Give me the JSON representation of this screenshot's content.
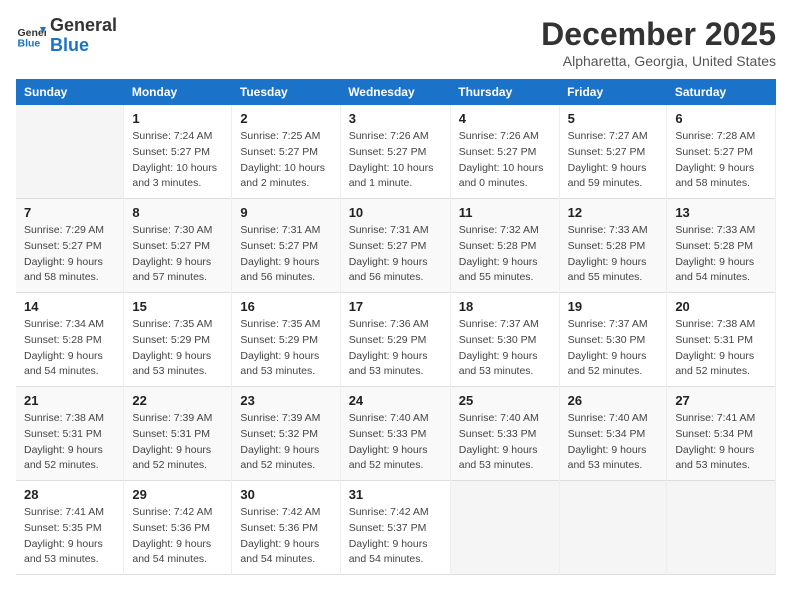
{
  "logo": {
    "line1": "General",
    "line2": "Blue"
  },
  "title": "December 2025",
  "location": "Alpharetta, Georgia, United States",
  "weekdays": [
    "Sunday",
    "Monday",
    "Tuesday",
    "Wednesday",
    "Thursday",
    "Friday",
    "Saturday"
  ],
  "weeks": [
    [
      {
        "day": "",
        "sunrise": "",
        "sunset": "",
        "daylight": ""
      },
      {
        "day": "1",
        "sunrise": "Sunrise: 7:24 AM",
        "sunset": "Sunset: 5:27 PM",
        "daylight": "Daylight: 10 hours and 3 minutes."
      },
      {
        "day": "2",
        "sunrise": "Sunrise: 7:25 AM",
        "sunset": "Sunset: 5:27 PM",
        "daylight": "Daylight: 10 hours and 2 minutes."
      },
      {
        "day": "3",
        "sunrise": "Sunrise: 7:26 AM",
        "sunset": "Sunset: 5:27 PM",
        "daylight": "Daylight: 10 hours and 1 minute."
      },
      {
        "day": "4",
        "sunrise": "Sunrise: 7:26 AM",
        "sunset": "Sunset: 5:27 PM",
        "daylight": "Daylight: 10 hours and 0 minutes."
      },
      {
        "day": "5",
        "sunrise": "Sunrise: 7:27 AM",
        "sunset": "Sunset: 5:27 PM",
        "daylight": "Daylight: 9 hours and 59 minutes."
      },
      {
        "day": "6",
        "sunrise": "Sunrise: 7:28 AM",
        "sunset": "Sunset: 5:27 PM",
        "daylight": "Daylight: 9 hours and 58 minutes."
      }
    ],
    [
      {
        "day": "7",
        "sunrise": "Sunrise: 7:29 AM",
        "sunset": "Sunset: 5:27 PM",
        "daylight": "Daylight: 9 hours and 58 minutes."
      },
      {
        "day": "8",
        "sunrise": "Sunrise: 7:30 AM",
        "sunset": "Sunset: 5:27 PM",
        "daylight": "Daylight: 9 hours and 57 minutes."
      },
      {
        "day": "9",
        "sunrise": "Sunrise: 7:31 AM",
        "sunset": "Sunset: 5:27 PM",
        "daylight": "Daylight: 9 hours and 56 minutes."
      },
      {
        "day": "10",
        "sunrise": "Sunrise: 7:31 AM",
        "sunset": "Sunset: 5:27 PM",
        "daylight": "Daylight: 9 hours and 56 minutes."
      },
      {
        "day": "11",
        "sunrise": "Sunrise: 7:32 AM",
        "sunset": "Sunset: 5:28 PM",
        "daylight": "Daylight: 9 hours and 55 minutes."
      },
      {
        "day": "12",
        "sunrise": "Sunrise: 7:33 AM",
        "sunset": "Sunset: 5:28 PM",
        "daylight": "Daylight: 9 hours and 55 minutes."
      },
      {
        "day": "13",
        "sunrise": "Sunrise: 7:33 AM",
        "sunset": "Sunset: 5:28 PM",
        "daylight": "Daylight: 9 hours and 54 minutes."
      }
    ],
    [
      {
        "day": "14",
        "sunrise": "Sunrise: 7:34 AM",
        "sunset": "Sunset: 5:28 PM",
        "daylight": "Daylight: 9 hours and 54 minutes."
      },
      {
        "day": "15",
        "sunrise": "Sunrise: 7:35 AM",
        "sunset": "Sunset: 5:29 PM",
        "daylight": "Daylight: 9 hours and 53 minutes."
      },
      {
        "day": "16",
        "sunrise": "Sunrise: 7:35 AM",
        "sunset": "Sunset: 5:29 PM",
        "daylight": "Daylight: 9 hours and 53 minutes."
      },
      {
        "day": "17",
        "sunrise": "Sunrise: 7:36 AM",
        "sunset": "Sunset: 5:29 PM",
        "daylight": "Daylight: 9 hours and 53 minutes."
      },
      {
        "day": "18",
        "sunrise": "Sunrise: 7:37 AM",
        "sunset": "Sunset: 5:30 PM",
        "daylight": "Daylight: 9 hours and 53 minutes."
      },
      {
        "day": "19",
        "sunrise": "Sunrise: 7:37 AM",
        "sunset": "Sunset: 5:30 PM",
        "daylight": "Daylight: 9 hours and 52 minutes."
      },
      {
        "day": "20",
        "sunrise": "Sunrise: 7:38 AM",
        "sunset": "Sunset: 5:31 PM",
        "daylight": "Daylight: 9 hours and 52 minutes."
      }
    ],
    [
      {
        "day": "21",
        "sunrise": "Sunrise: 7:38 AM",
        "sunset": "Sunset: 5:31 PM",
        "daylight": "Daylight: 9 hours and 52 minutes."
      },
      {
        "day": "22",
        "sunrise": "Sunrise: 7:39 AM",
        "sunset": "Sunset: 5:31 PM",
        "daylight": "Daylight: 9 hours and 52 minutes."
      },
      {
        "day": "23",
        "sunrise": "Sunrise: 7:39 AM",
        "sunset": "Sunset: 5:32 PM",
        "daylight": "Daylight: 9 hours and 52 minutes."
      },
      {
        "day": "24",
        "sunrise": "Sunrise: 7:40 AM",
        "sunset": "Sunset: 5:33 PM",
        "daylight": "Daylight: 9 hours and 52 minutes."
      },
      {
        "day": "25",
        "sunrise": "Sunrise: 7:40 AM",
        "sunset": "Sunset: 5:33 PM",
        "daylight": "Daylight: 9 hours and 53 minutes."
      },
      {
        "day": "26",
        "sunrise": "Sunrise: 7:40 AM",
        "sunset": "Sunset: 5:34 PM",
        "daylight": "Daylight: 9 hours and 53 minutes."
      },
      {
        "day": "27",
        "sunrise": "Sunrise: 7:41 AM",
        "sunset": "Sunset: 5:34 PM",
        "daylight": "Daylight: 9 hours and 53 minutes."
      }
    ],
    [
      {
        "day": "28",
        "sunrise": "Sunrise: 7:41 AM",
        "sunset": "Sunset: 5:35 PM",
        "daylight": "Daylight: 9 hours and 53 minutes."
      },
      {
        "day": "29",
        "sunrise": "Sunrise: 7:42 AM",
        "sunset": "Sunset: 5:36 PM",
        "daylight": "Daylight: 9 hours and 54 minutes."
      },
      {
        "day": "30",
        "sunrise": "Sunrise: 7:42 AM",
        "sunset": "Sunset: 5:36 PM",
        "daylight": "Daylight: 9 hours and 54 minutes."
      },
      {
        "day": "31",
        "sunrise": "Sunrise: 7:42 AM",
        "sunset": "Sunset: 5:37 PM",
        "daylight": "Daylight: 9 hours and 54 minutes."
      },
      {
        "day": "",
        "sunrise": "",
        "sunset": "",
        "daylight": ""
      },
      {
        "day": "",
        "sunrise": "",
        "sunset": "",
        "daylight": ""
      },
      {
        "day": "",
        "sunrise": "",
        "sunset": "",
        "daylight": ""
      }
    ]
  ]
}
